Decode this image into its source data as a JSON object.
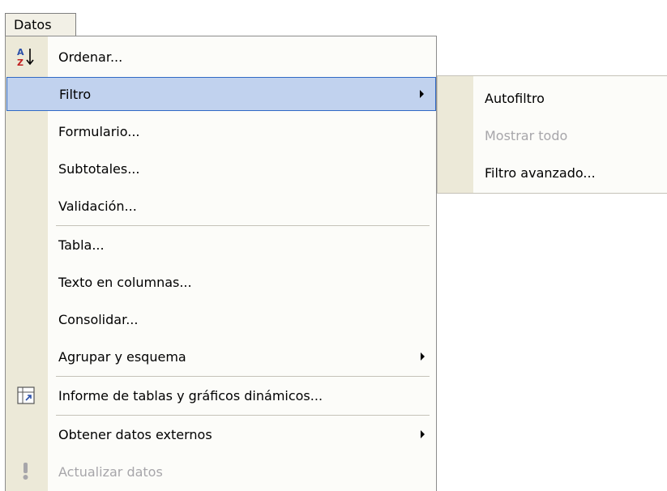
{
  "menubar": {
    "datos_label": "Datos"
  },
  "menu": {
    "items": [
      {
        "label": "Ordenar...",
        "icon": "sort-az-icon"
      },
      {
        "label": "Filtro",
        "submenu": true,
        "highlighted": true
      },
      {
        "label": "Formulario..."
      },
      {
        "label": "Subtotales..."
      },
      {
        "label": "Validación..."
      },
      {
        "label": "Tabla..."
      },
      {
        "label": "Texto en columnas..."
      },
      {
        "label": "Consolidar..."
      },
      {
        "label": "Agrupar y esquema",
        "submenu": true
      },
      {
        "label": "Informe de tablas y gráficos dinámicos...",
        "icon": "pivot-table-icon"
      },
      {
        "label": "Obtener datos externos",
        "submenu": true
      },
      {
        "label": "Actualizar datos",
        "icon": "refresh-data-icon",
        "disabled": true
      }
    ]
  },
  "submenu": {
    "items": [
      {
        "label": "Autofiltro"
      },
      {
        "label": "Mostrar todo",
        "disabled": true
      },
      {
        "label": "Filtro avanzado..."
      }
    ]
  },
  "colors": {
    "highlight_fill": "#c1d2ee",
    "highlight_border": "#316ac5",
    "gutter": "#ece9d8",
    "disabled_text": "#a7a6aa"
  }
}
